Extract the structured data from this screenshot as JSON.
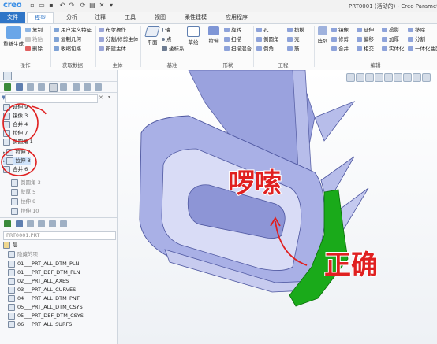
{
  "app": {
    "logo": "creo",
    "title": "PRT0001 (活动的) - Creo Parametric"
  },
  "tabs": [
    "文件",
    "模型",
    "分析",
    "注释",
    "工具",
    "视图",
    "柔性建模",
    "应用程序"
  ],
  "active_tab": "模型",
  "ribbon": {
    "col1": {
      "big": "重新生成",
      "items": [
        "复制",
        "粘贴",
        "删除"
      ]
    },
    "col2": {
      "items": [
        "用户定义特征",
        "复制几何",
        "收缩包络"
      ]
    },
    "col3": {
      "items": [
        "布尔操作",
        "分割/修剪主体",
        "新建主体"
      ]
    },
    "col4": {
      "big": "平面",
      "items": [
        "轴",
        "点",
        "坐标系"
      ]
    },
    "col5": {
      "big": "草绘"
    },
    "col6": {
      "big": "拉伸",
      "items": [
        "旋转",
        "扫描",
        "扫描混合"
      ]
    },
    "col7": {
      "items": [
        "孔",
        "倒圆角",
        "倒角"
      ]
    },
    "col8": {
      "items": [
        "拔模",
        "壳",
        "筋"
      ]
    },
    "col9": {
      "big": "阵列"
    },
    "col10": {
      "items": [
        "镜像",
        "延伸",
        "投影",
        "修剪",
        "偏移",
        "加厚",
        "合并",
        "相交",
        "实体化"
      ]
    },
    "col11": {
      "items": [
        "移除",
        "分割",
        "一体化曲面"
      ]
    },
    "groups": [
      "操作",
      "获取数据",
      "主体",
      "基准",
      "形状",
      "工程",
      "编辑"
    ]
  },
  "model_tree": {
    "items": [
      {
        "label": "延伸 9",
        "icon": "extend-icon",
        "state": "normal"
      },
      {
        "label": "镜像 3",
        "icon": "mirror-icon",
        "state": "normal"
      },
      {
        "label": "合并 4",
        "icon": "merge-icon",
        "state": "normal"
      },
      {
        "label": "拉伸 7",
        "icon": "extrude-icon",
        "state": "normal"
      },
      {
        "label": "倒圆角 1",
        "icon": "round-icon",
        "state": "normal"
      },
      {
        "label": "拉伸 7",
        "icon": "extrude-icon",
        "state": "normal"
      },
      {
        "label": "拉伸 8",
        "icon": "extrude-icon",
        "state": "selected"
      },
      {
        "label": "合并 6",
        "icon": "merge-icon",
        "state": "normal"
      },
      {
        "label": "倒圆角 3",
        "icon": "round-icon",
        "state": "dim"
      },
      {
        "label": "壁厚 5",
        "icon": "shell-icon",
        "state": "dim"
      },
      {
        "label": "拉伸 9",
        "icon": "extrude-icon",
        "state": "dim"
      },
      {
        "label": "拉伸 10",
        "icon": "extrude-icon",
        "state": "dim"
      }
    ]
  },
  "layer_tree": {
    "model_name": "PRT0001.PRT",
    "header": "层",
    "items": [
      "隐藏的项",
      "01___PRT_ALL_DTM_PLN",
      "01___PRT_DEF_DTM_PLN",
      "02___PRT_ALL_AXES",
      "03___PRT_ALL_CURVES",
      "04___PRT_ALL_DTM_PNT",
      "05___PRT_ALL_DTM_CSYS",
      "05___PRT_DEF_DTM_CSYS",
      "06___PRT_ALL_SURFS"
    ]
  },
  "annotations": {
    "wordy_label": "啰嗦",
    "correct_label": "正确",
    "annotation_color": "#e02020",
    "model_color": "#8f97d8",
    "highlight_color": "#1aaa1a"
  }
}
